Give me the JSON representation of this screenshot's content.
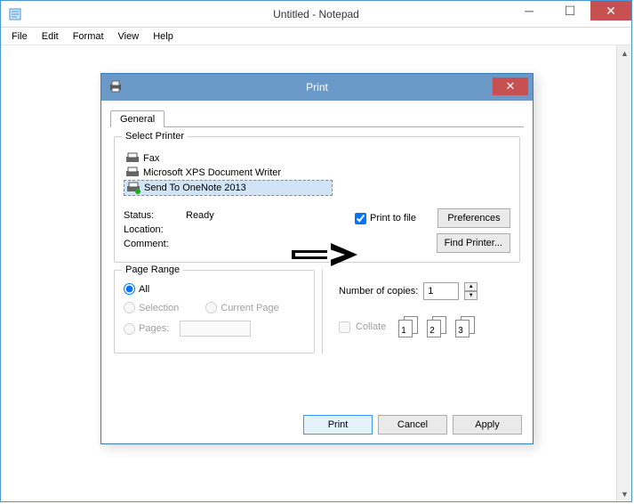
{
  "window": {
    "title": "Untitled - Notepad"
  },
  "menubar": {
    "file": "File",
    "edit": "Edit",
    "format": "Format",
    "view": "View",
    "help": "Help"
  },
  "dialog": {
    "title": "Print",
    "tab": "General",
    "selectPrinterLabel": "Select Printer",
    "printers": {
      "fax": "Fax",
      "xps": "Microsoft XPS Document Writer",
      "onenote": "Send To OneNote 2013"
    },
    "statusLabel": "Status:",
    "statusValue": "Ready",
    "locationLabel": "Location:",
    "commentLabel": "Comment:",
    "printToFileLabel": "Print to file",
    "printToFileChecked": true,
    "preferencesLabel": "Preferences",
    "findPrinterLabel": "Find Printer...",
    "pageRange": {
      "title": "Page Range",
      "all": "All",
      "selection": "Selection",
      "currentPage": "Current Page",
      "pages": "Pages:"
    },
    "copies": {
      "label": "Number of copies:",
      "value": "1",
      "collateLabel": "Collate",
      "p1": "1",
      "p2": "2",
      "p3": "3"
    },
    "buttons": {
      "print": "Print",
      "cancel": "Cancel",
      "apply": "Apply"
    }
  }
}
